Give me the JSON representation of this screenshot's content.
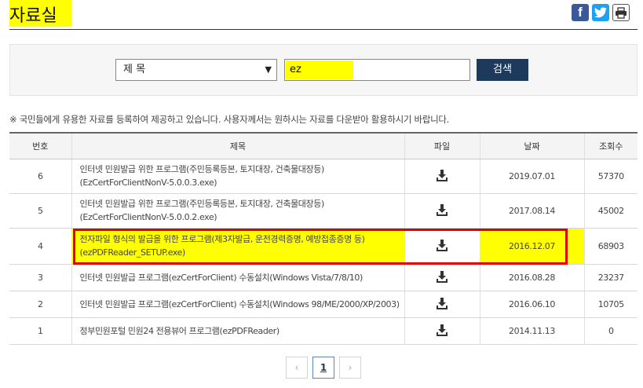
{
  "page": {
    "title": "자료실"
  },
  "share": {
    "facebook_icon": "facebook-icon",
    "twitter_icon": "twitter-icon",
    "print_icon": "print-icon"
  },
  "search": {
    "field_select": "제  목",
    "query": "ez",
    "button_label": "검색"
  },
  "notice": "※ 국민들에게 유용한 자료를 등록하여 제공하고 있습니다. 사용자께서는 원하시는 자료를 다운받아 활용하시기 바랍니다.",
  "table": {
    "headers": [
      "번호",
      "제목",
      "파일",
      "날짜",
      "조회수"
    ],
    "rows": [
      {
        "no": "6",
        "title": "인터넷 민원발급 위한 프로그램(주민등록등본, 토지대장, 건축물대장등)",
        "file": "(EzCertForClientNonV-5.0.0.3.exe)",
        "date": "2019.07.01",
        "views": "57370",
        "highlighted": false
      },
      {
        "no": "5",
        "title": "인터넷 민원발급 위한 프로그램(주민등록등본, 토지대장, 건축물대장등)",
        "file": "(EzCertForClientNonV-5.0.0.2.exe)",
        "date": "2017.08.14",
        "views": "45002",
        "highlighted": false
      },
      {
        "no": "4",
        "title": "전자파일 형식의 발급을 위한 프로그램(제3자발급, 운전경력증명, 예방접종증명 등)",
        "file": "(ezPDFReader_SETUP.exe)",
        "date": "2016.12.07",
        "views": "68903",
        "highlighted": true
      },
      {
        "no": "3",
        "title": "인터넷 민원발급 프로그램(ezCertForClient) 수동설치(Windows Vista/7/8/10)",
        "file": "",
        "date": "2016.08.28",
        "views": "23237",
        "highlighted": false
      },
      {
        "no": "2",
        "title": "인터넷 민원발급 프로그램(ezCertForClient) 수동설치(Windows 98/ME/2000/XP/2003)",
        "file": "",
        "date": "2016.06.10",
        "views": "10705",
        "highlighted": false
      },
      {
        "no": "1",
        "title": "정부민원포털 민원24 전용뷰어 프로그램(ezPDFReader)",
        "file": "",
        "date": "2014.11.13",
        "views": "0",
        "highlighted": false
      }
    ],
    "download_icon": "download-icon"
  },
  "pagination": {
    "prev": "‹",
    "current": "1",
    "next": "›"
  },
  "colors": {
    "highlight": "#ffff00",
    "annotation_box": "#e00000",
    "search_button": "#1d3a5c"
  }
}
